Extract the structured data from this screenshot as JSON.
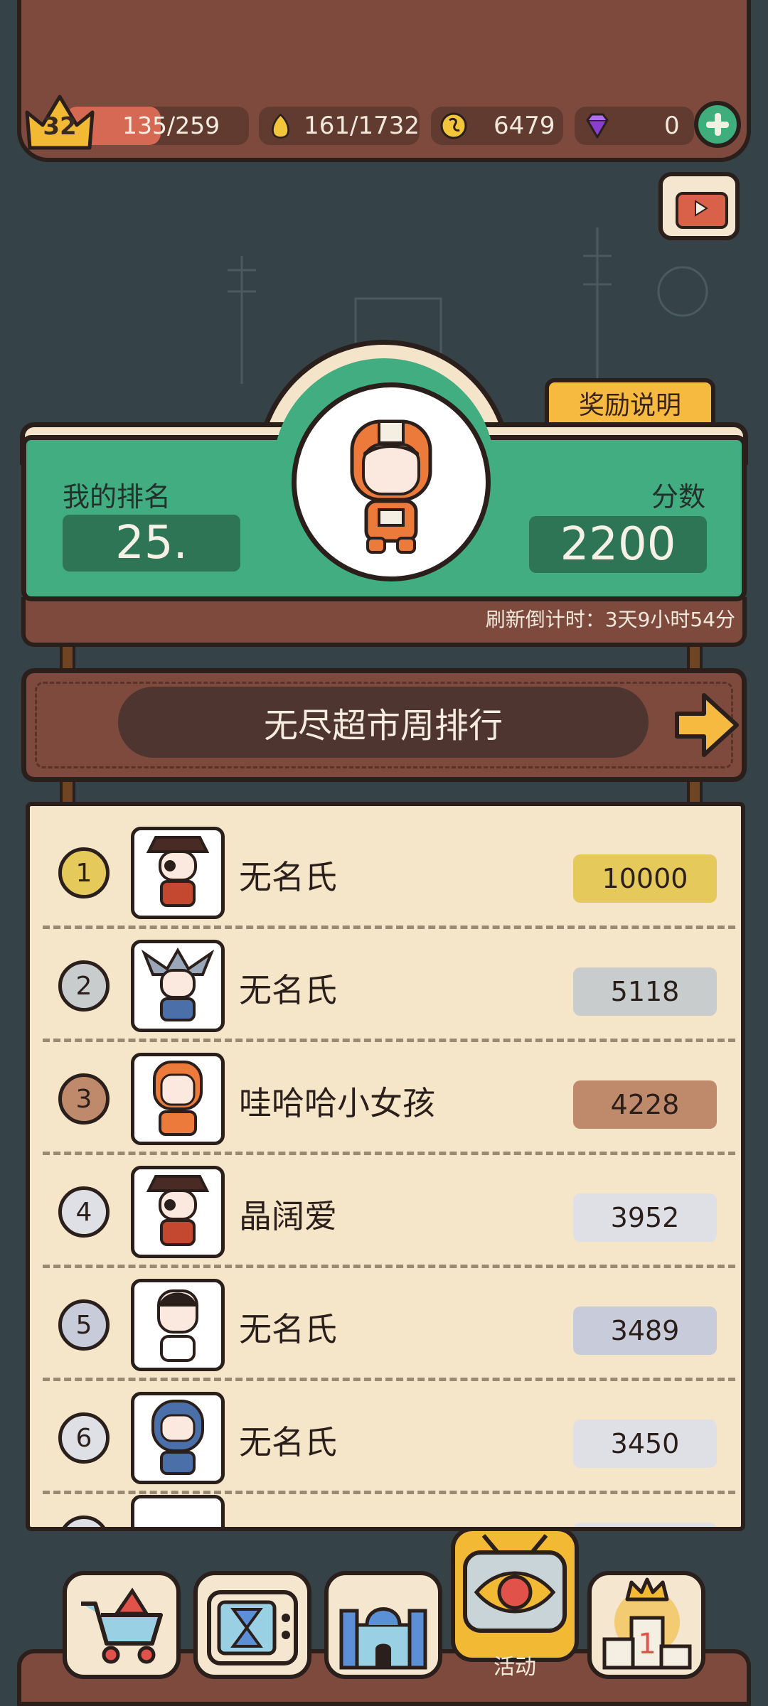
{
  "resources": {
    "level": "32",
    "xp": "135/259",
    "xp_fraction": 0.52,
    "food": "161/1732",
    "coins": "6479",
    "gems": "0"
  },
  "header": {
    "reward_info": "奖励说明",
    "my_rank_label": "我的排名",
    "my_rank_value": "25.",
    "score_label": "分数",
    "score_value": "2200",
    "refresh_countdown": "刷新倒计时：3天9小时54分"
  },
  "leaderboard_title": "无尽超市周排行",
  "rankings": [
    {
      "rank": "1",
      "name": "无名氏",
      "score": "10000",
      "color": "#e6c95b",
      "avatar": "pirate"
    },
    {
      "rank": "2",
      "name": "无名氏",
      "score": "5118",
      "color": "#c8cccd",
      "avatar": "knight"
    },
    {
      "rank": "3",
      "name": "哇哈哈小女孩",
      "score": "4228",
      "color": "#bf8a6b",
      "avatar": "astronaut"
    },
    {
      "rank": "4",
      "name": "晶阔爱",
      "score": "3952",
      "color": "#dfe0e6",
      "avatar": "pirate"
    },
    {
      "rank": "5",
      "name": "无名氏",
      "score": "3489",
      "color": "#c8cbd9",
      "avatar": "plain"
    },
    {
      "rank": "6",
      "name": "无名氏",
      "score": "3450",
      "color": "#dfe0e6",
      "avatar": "diver"
    }
  ],
  "nav": {
    "active_label": "活动",
    "items": [
      "cart-icon",
      "tv-hourglass-icon",
      "castle-icon",
      "tv-eye-icon",
      "podium-icon"
    ]
  },
  "colors": {
    "background": "#354349",
    "board_brown": "#7d4a3d",
    "panel_green": "#41ad80",
    "list_cream": "#f5e5c9",
    "accent_orange": "#f7ba40"
  }
}
